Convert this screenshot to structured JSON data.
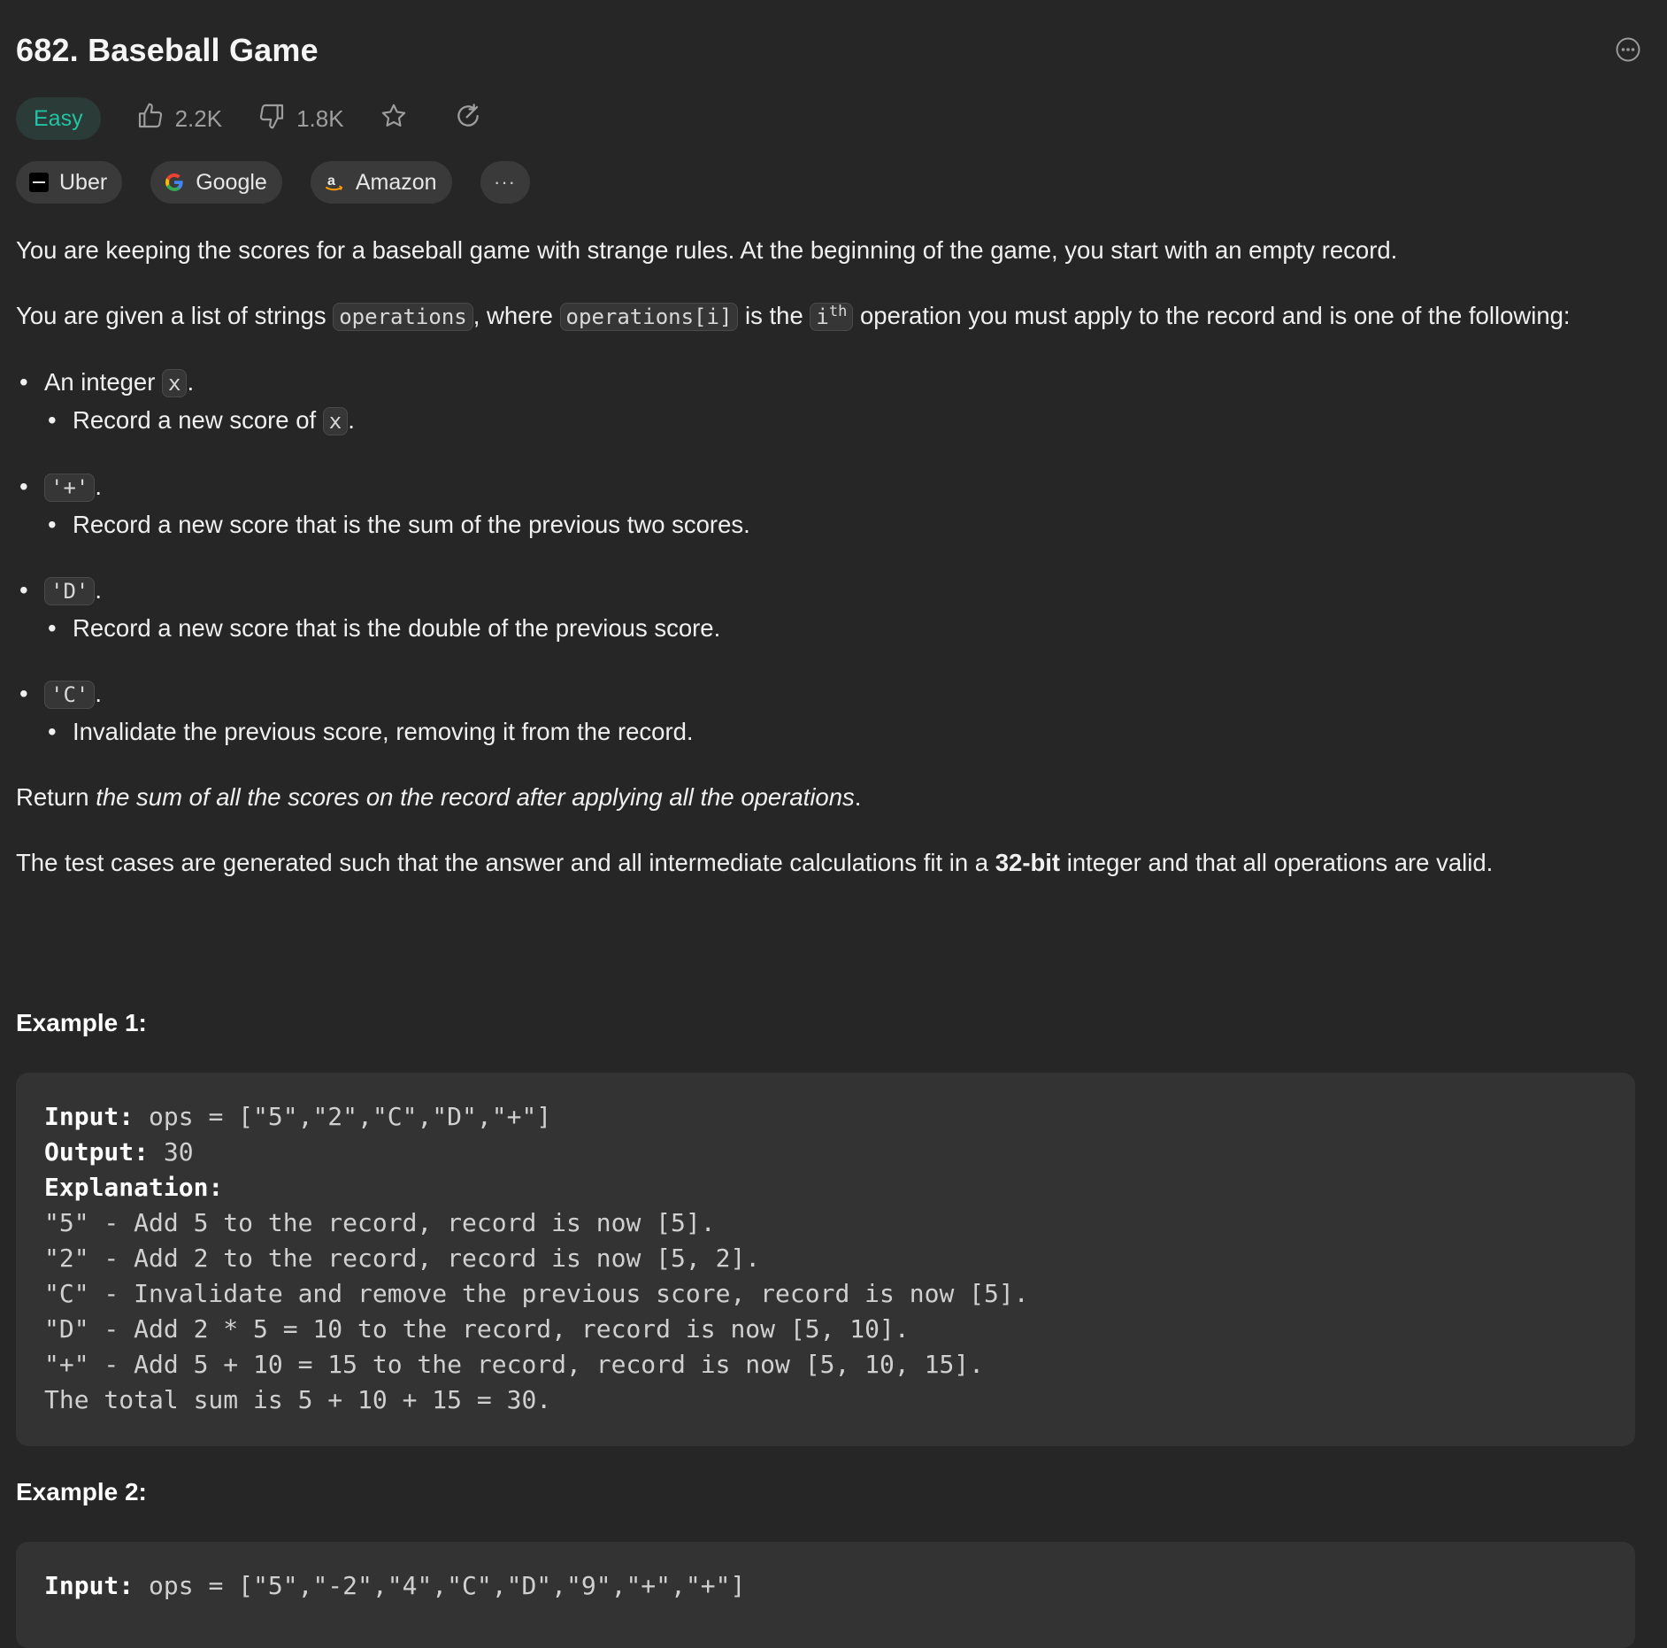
{
  "problem": {
    "title": "682. Baseball Game",
    "difficulty": "Easy",
    "likes": "2.2K",
    "dislikes": "1.8K"
  },
  "companies": [
    "Uber",
    "Google",
    "Amazon"
  ],
  "more_label": "···",
  "description": {
    "p1": "You are keeping the scores for a baseball game with strange rules. At the beginning of the game, you start with an empty record.",
    "p2_a": "You are given a list of strings ",
    "p2_code1": "operations",
    "p2_b": ", where ",
    "p2_code2": "operations[i]",
    "p2_c": " is the ",
    "p2_code3_base": "i",
    "p2_code3_sup": "th",
    "p2_d": " operation you must apply to the record and is one of the following:",
    "op1_a": "An integer ",
    "op1_code": "x",
    "op1_end": ".",
    "op1_sub_a": "Record a new score of ",
    "op1_sub_code": "x",
    "op1_sub_end": ".",
    "op2_code": "'+'",
    "op2_end": ".",
    "op2_sub": "Record a new score that is the sum of the previous two scores.",
    "op3_code": "'D'",
    "op3_end": ".",
    "op3_sub": "Record a new score that is the double of the previous score.",
    "op4_code": "'C'",
    "op4_end": ".",
    "op4_sub": "Invalidate the previous score, removing it from the record.",
    "ret_a": "Return ",
    "ret_em": "the sum of all the scores on the record after applying all the operations",
    "ret_end": ".",
    "tc_a": "The test cases are generated such that the answer and all intermediate calculations fit in a ",
    "tc_b": "32-bit",
    "tc_c": " integer and that all operations are valid."
  },
  "example1": {
    "title": "Example 1:",
    "input_label": "Input:",
    "input": " ops = [\"5\",\"2\",\"C\",\"D\",\"+\"]",
    "output_label": "Output:",
    "output": " 30",
    "explanation_label": "Explanation:",
    "lines": [
      "\"5\" - Add 5 to the record, record is now [5].",
      "\"2\" - Add 2 to the record, record is now [5, 2].",
      "\"C\" - Invalidate and remove the previous score, record is now [5].",
      "\"D\" - Add 2 * 5 = 10 to the record, record is now [5, 10].",
      "\"+\" - Add 5 + 10 = 15 to the record, record is now [5, 10, 15].",
      "The total sum is 5 + 10 + 15 = 30."
    ]
  },
  "example2": {
    "title": "Example 2:",
    "input_label": "Input:",
    "input": " ops = [\"5\",\"-2\",\"4\",\"C\",\"D\",\"9\",\"+\",\"+\"]"
  },
  "colors": {
    "background": "#262626",
    "easy": "#22c3a3",
    "code_block": "#333333"
  }
}
